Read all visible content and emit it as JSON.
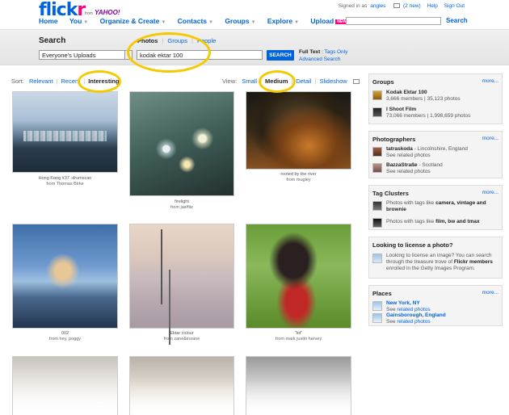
{
  "colors": {
    "brand_blue": "#0063dc",
    "brand_pink": "#ff0084",
    "highlight": "#f5c900"
  },
  "header": {
    "logo_main": "flick",
    "logo_r": "r",
    "from": "from",
    "yahoo": "YAHOO!",
    "signed_in_label": "Signed in as",
    "username": "angles",
    "new_messages": "(2 new)",
    "help": "Help",
    "sign_out": "Sign Out",
    "nav": [
      "Home",
      "You",
      "Organize & Create",
      "Contacts",
      "Groups",
      "Explore",
      "Upload"
    ],
    "new_badge": "NEW",
    "search_button": "Search"
  },
  "search": {
    "title": "Search",
    "tabs": [
      "Photos",
      "Groups",
      "People"
    ],
    "scope": "Everyone's Uploads",
    "query": "kodak ektar 100",
    "button": "SEARCH",
    "full_text": "Full Text",
    "tags_only": "Tags Only",
    "advanced": "Advanced Search"
  },
  "sort": {
    "label": "Sort:",
    "options": [
      "Relevant",
      "Recent",
      "Interesting"
    ],
    "current": "Interesting"
  },
  "view": {
    "label": "View:",
    "options": [
      "Small",
      "Medium",
      "Detail",
      "Slideshow"
    ],
    "current": "Medium"
  },
  "photos": [
    {
      "title": "Hong Kong #37 -drumscan",
      "by": "from Thomas Birke"
    },
    {
      "title": "firelight",
      "by": "from jas/fitz"
    },
    {
      "title": "rooted by the river",
      "by": "from mugley"
    },
    {
      "title": "002",
      "by": "from hey, poggy"
    },
    {
      "title": "Ektar colour",
      "by": "from zane&inzane"
    },
    {
      "title": "\"kit\"",
      "by": "from mark justin harvey"
    },
    {
      "title": "",
      "by": ""
    },
    {
      "title": "",
      "by": ""
    },
    {
      "title": "",
      "by": ""
    }
  ],
  "sidebar": {
    "more": "more...",
    "groups": {
      "title": "Groups",
      "items": [
        {
          "name": "Kodak Ektar 100",
          "stats": "3,666 members | 35,123 photos"
        },
        {
          "name": "I Shoot Film",
          "stats": "73,066 members | 1,998,659 photos"
        }
      ]
    },
    "photographers": {
      "title": "Photographers",
      "items": [
        {
          "name": "tatraskoda",
          "loc": " - Lincolnshire, England",
          "see": "See related photos"
        },
        {
          "name": "BazzaStraße",
          "loc": " - Scotland",
          "see": "See related photos"
        }
      ]
    },
    "tag_clusters": {
      "title": "Tag Clusters",
      "items": [
        {
          "line1_pre": "Photos with tags like ",
          "line1_b": "camera, vintage and",
          "line2_b": "brownie"
        },
        {
          "line1_pre": "Photos with tags like ",
          "line1_b": "film, bw and tmax"
        }
      ]
    },
    "license": {
      "title": "Looking to license a photo?",
      "line1": "Looking to license an image? You can search",
      "line2_pre": "through the treasure trove of ",
      "line2_b": "Flickr members",
      "line3": "enrolled in the Getty Images Program."
    },
    "places": {
      "title": "Places",
      "items": [
        {
          "name": "New York, NY",
          "see_pre": "See ",
          "see_link": "related photos"
        },
        {
          "name": "Gainsborough, England",
          "see_pre": "See ",
          "see_link": "related photos"
        }
      ]
    }
  }
}
